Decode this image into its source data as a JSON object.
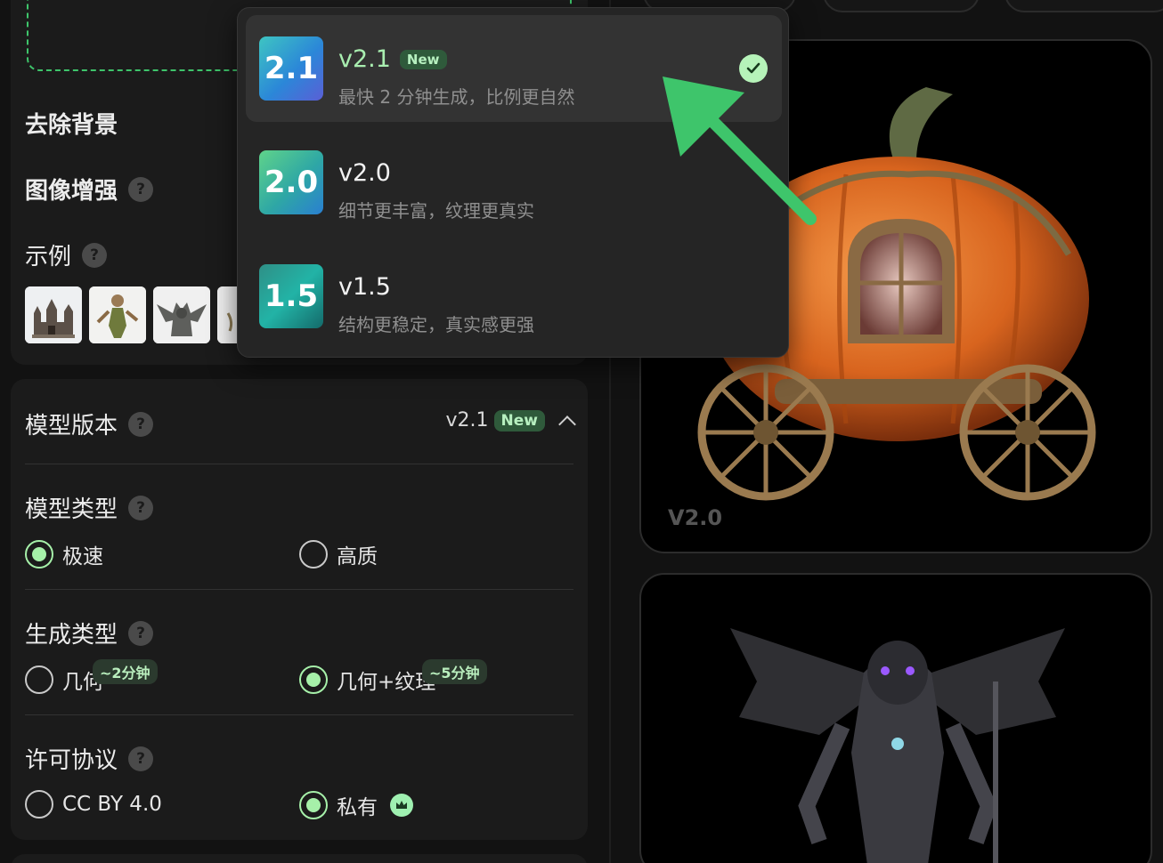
{
  "colors": {
    "accent_green": "#a6f0a9",
    "arrow_green": "#3ec56b",
    "panel_bg": "#1b1b1b",
    "page_bg": "#121212"
  },
  "left": {
    "remove_bg_label": "去除背景",
    "enhance_label": "图像增强",
    "examples_label": "示例",
    "help_glyph": "?"
  },
  "model": {
    "section_label": "模型版本",
    "current_version": "v2.1",
    "new_badge": "New",
    "model_type": {
      "label": "模型类型",
      "options": [
        "极速",
        "高质"
      ],
      "selected": 0
    },
    "gen_type": {
      "label": "生成类型",
      "options": [
        "几何",
        "几何+纹理"
      ],
      "times": [
        "~2分钟",
        "~5分钟"
      ],
      "selected": 1
    },
    "license": {
      "label": "许可协议",
      "options": [
        "CC BY 4.0",
        "私有"
      ],
      "selected": 1
    }
  },
  "dropdown": {
    "options": [
      {
        "icon_text": "2.1",
        "version": "v2.1",
        "badge": "New",
        "desc": "最快 2 分钟生成，比例更自然",
        "selected": true
      },
      {
        "icon_text": "2.0",
        "version": "v2.0",
        "badge": "",
        "desc": "细节更丰富，纹理更真实",
        "selected": false
      },
      {
        "icon_text": "1.5",
        "version": "v1.5",
        "badge": "",
        "desc": "结构更稳定，真实感更强",
        "selected": false
      }
    ]
  },
  "preview": {
    "tag_1": "V2.0"
  }
}
